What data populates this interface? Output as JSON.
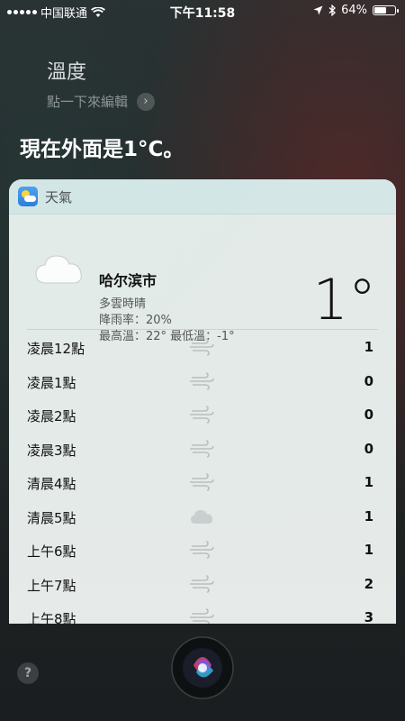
{
  "status": {
    "carrier": "中国联通",
    "time": "下午11:58",
    "battery": "64%",
    "battery_level": 0.64
  },
  "query": {
    "text": "溫度",
    "edit_hint": "點一下來編輯"
  },
  "answer": "現在外面是1°C。",
  "card": {
    "app_name": "天氣",
    "city": "哈尔滨市",
    "condition": "多雲時晴",
    "rain_chance": "降雨率：20%",
    "hi_lo": "最高溫：22° 最低溫：-1°",
    "temperature": "1°",
    "hourly": [
      {
        "time": "凌晨12點",
        "icon": "wind-icon",
        "value": "1"
      },
      {
        "time": "凌晨1點",
        "icon": "wind-icon",
        "value": "0"
      },
      {
        "time": "凌晨2點",
        "icon": "wind-icon",
        "value": "0"
      },
      {
        "time": "凌晨3點",
        "icon": "wind-icon",
        "value": "0"
      },
      {
        "time": "清晨4點",
        "icon": "wind-icon",
        "value": "1"
      },
      {
        "time": "清晨5點",
        "icon": "cloud-icon",
        "value": "1"
      },
      {
        "time": "上午6點",
        "icon": "wind-icon",
        "value": "1"
      },
      {
        "time": "上午7點",
        "icon": "wind-icon",
        "value": "2"
      },
      {
        "time": "上午8點",
        "icon": "wind-icon",
        "value": "3"
      }
    ]
  },
  "help_label": "?"
}
